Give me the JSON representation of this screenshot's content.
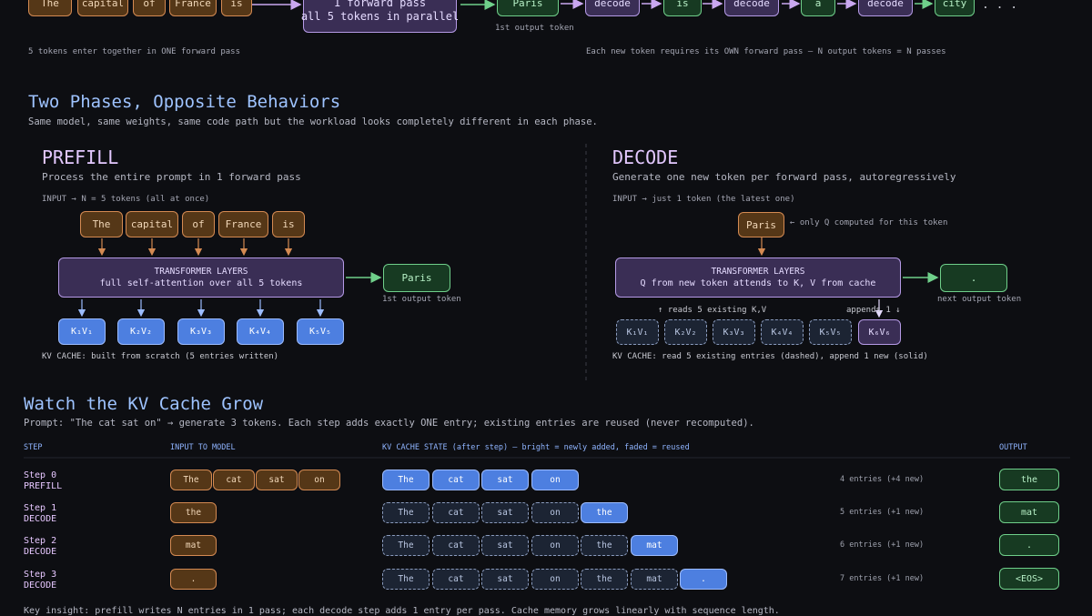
{
  "top": {
    "tokens": [
      "The",
      "capital",
      "of",
      "France",
      "is"
    ],
    "forward_box": [
      "1 forward pass",
      "all 5 tokens in parallel"
    ],
    "paris": "Paris",
    "first_output_label": "1st output token",
    "decode_chain": [
      "decode",
      "is",
      "decode",
      "a",
      "decode",
      "city"
    ],
    "ellipsis": ". . .",
    "left_caption": "5 tokens enter together in ONE forward pass",
    "right_caption": "Each new token requires its OWN forward pass — N output tokens = N passes"
  },
  "phases": {
    "title": "Two Phases, Opposite Behaviors",
    "subtitle": "Same model, same weights, same code path but the workload looks completely different in each phase."
  },
  "prefill": {
    "title": "PREFILL",
    "desc": "Process the entire prompt in 1 forward pass",
    "input_label": "INPUT  →  N = 5 tokens (all at once)",
    "tokens": [
      "The",
      "capital",
      "of",
      "France",
      "is"
    ],
    "layer_title": "TRANSFORMER LAYERS",
    "layer_sub": "full self-attention over all 5 tokens",
    "output": "Paris",
    "output_label": "1st output token",
    "kv": [
      "K₁V₁",
      "K₂V₂",
      "K₃V₃",
      "K₄V₄",
      "K₅V₅"
    ],
    "kv_caption": "KV CACHE: built from scratch (5 entries written)"
  },
  "decode": {
    "title": "DECODE",
    "desc": "Generate one new token per forward pass, autoregressively",
    "input_label": "INPUT  →  just 1 token (the latest one)",
    "token": "Paris",
    "token_note": "← only Q computed for this token",
    "layer_title": "TRANSFORMER LAYERS",
    "layer_sub": "Q from new token attends to K, V from cache",
    "output": ".",
    "output_label": "next output token",
    "reads_label": "↑ reads 5 existing K,V",
    "appends_label": "appends 1 ↓",
    "kv_existing": [
      "K₁V₁",
      "K₂V₂",
      "K₃V₃",
      "K₄V₄",
      "K₅V₅"
    ],
    "kv_new": "K₆V₆",
    "kv_caption": "KV CACHE: read 5 existing entries (dashed), append 1 new (solid)"
  },
  "grow": {
    "title": "Watch the KV Cache Grow",
    "prompt": "Prompt: \"The cat sat on\"  →  generate 3 tokens.  Each step adds exactly ONE entry; existing entries are reused (never recomputed).",
    "headers": {
      "step": "STEP",
      "input": "INPUT TO MODEL",
      "kv": "KV CACHE STATE  (after step)  —  bright = newly added, faded = reused",
      "output": "OUTPUT"
    },
    "rows": [
      {
        "step": "Step 0",
        "phase": "PREFILL",
        "inputs": [
          "The",
          "cat",
          "sat",
          "on"
        ],
        "cache": [
          "The",
          "cat",
          "sat",
          "on"
        ],
        "new_index": -1,
        "count": "4 entries  (+4 new)",
        "output": "the"
      },
      {
        "step": "Step 1",
        "phase": "DECODE",
        "inputs": [
          "the"
        ],
        "cache": [
          "The",
          "cat",
          "sat",
          "on",
          "the"
        ],
        "new_index": 4,
        "count": "5 entries  (+1 new)",
        "output": "mat"
      },
      {
        "step": "Step 2",
        "phase": "DECODE",
        "inputs": [
          "mat"
        ],
        "cache": [
          "The",
          "cat",
          "sat",
          "on",
          "the",
          "mat"
        ],
        "new_index": 5,
        "count": "6 entries  (+1 new)",
        "output": "."
      },
      {
        "step": "Step 3",
        "phase": "DECODE",
        "inputs": [
          "."
        ],
        "cache": [
          "The",
          "cat",
          "sat",
          "on",
          "the",
          "mat",
          "."
        ],
        "new_index": 6,
        "count": "7 entries  (+1 new)",
        "output": "<EOS>"
      }
    ],
    "footer": "Key insight:  prefill writes N entries in 1 pass; each decode step adds 1 entry per pass. Cache memory grows linearly with sequence length."
  }
}
